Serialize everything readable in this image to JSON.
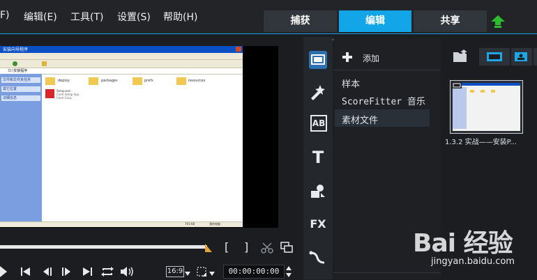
{
  "menu": {
    "file": "F)",
    "edit": "编辑(E)",
    "tools": "工具(T)",
    "settings": "设置(S)",
    "help": "帮助(H)"
  },
  "tabs": {
    "capture": "捕获",
    "edit": "编辑",
    "share": "共享"
  },
  "preview": {
    "aspect": "16:9",
    "timecode": "00:00:00:00",
    "mark_in": "[",
    "mark_out": "]",
    "screenshot": {
      "title": "安装向导程序",
      "address": "D:\\安装程序",
      "sidebar_1": "文件和文件夹任务",
      "sidebar_2": "其它位置",
      "sidebar_3": "详细信息",
      "folders": [
        "deploy",
        "packages",
        "prefs",
        "resources"
      ],
      "setup_name": "Setup.exe",
      "setup_desc_1": "Corel Setup App",
      "setup_desc_2": "Corel Corp.",
      "status_left": "",
      "status_size": "793 KB",
      "status_right": "我的电脑"
    }
  },
  "library": {
    "add_label": "添加",
    "items": [
      "样本",
      "ScoreFitter 音乐",
      "素材文件"
    ],
    "selected_index": 2
  },
  "media": {
    "thumb_label": "1.3.2 实战——安装P..."
  },
  "watermark": {
    "text": "Bai 经验",
    "url": "jingyan.baidu.com"
  },
  "colors": {
    "accent": "#12a5e8",
    "upload_green": "#2dbd2d"
  }
}
